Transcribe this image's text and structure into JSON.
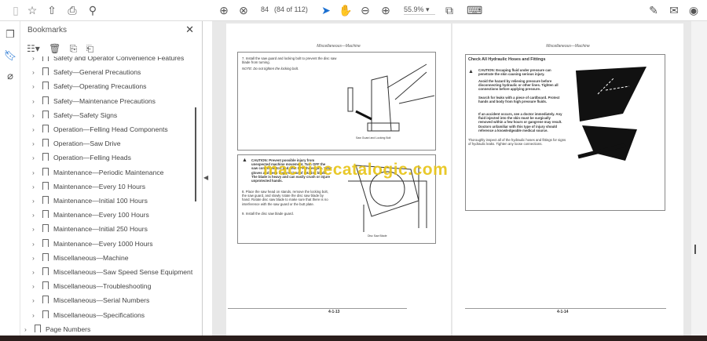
{
  "toolbar": {
    "page_input": "84",
    "page_count": "(84 of 112)",
    "zoom": "55.9%"
  },
  "bookmarks": {
    "title": "Bookmarks",
    "items": [
      "Safety and Operator Convenience Features",
      "Safety—General Precautions",
      "Safety—Operating Precautions",
      "Safety—Maintenance Precautions",
      "Safety—Safety Signs",
      "Operation—Felling Head Components",
      "Operation—Saw Drive",
      "Operation—Felling Heads",
      "Maintenance—Periodic Maintenance",
      "Maintenance—Every 10 Hours",
      "Maintenance—Initial 100 Hours",
      "Maintenance—Every 100 Hours",
      "Maintenance—Initial 250 Hours",
      "Maintenance—Every 1000 Hours",
      "Miscellaneous—Machine",
      "Miscellaneous—Saw Speed Sense Equipment",
      "Miscellaneous—Troubleshooting",
      "Miscellaneous—Serial Numbers",
      "Miscellaneous—Specifications"
    ],
    "root": "Page Numbers"
  },
  "left_page": {
    "header": "Miscellaneous—Machine",
    "step7": "7. Install the saw guard and locking bolt to prevent the disc saw blade from turning.",
    "note": "NOTE: Do not tighten the locking bolt.",
    "fig1": "Saw Guard and Locking Bolt",
    "caution": "CAUTION: Prevent possible injury from unexpected machine movement. Turn OFF the saw control switch and shut OFF the engine. Wear gloves and keep fingers clear of rotating blade. The blade is heavy and can easily crush or injure unprotected hands.",
    "step8": "8. Place the saw head on stands, remove the locking bolt, the saw guard, and slowly rotate the disc saw blade by hand. Rotate disc saw blade to make sure that there is no interference with the saw guard or the butt plate.",
    "step9": "9. Install the disc saw blade guard.",
    "fig2": "Disc Saw Blade",
    "page_no": "4-1-13"
  },
  "right_page": {
    "header": "Miscellaneous—Machine",
    "title": "Check All Hydraulic Hoses and Fittings",
    "caution": "CAUTION: Escaping fluid under pressure can penetrate the skin causing serious injury.",
    "p1": "Avoid the hazard by relieving pressure before disconnecting hydraulic or other lines. Tighten all connections before applying pressure.",
    "p2": "Search for leaks with a piece of cardboard. Protect hands and body from high pressure fluids.",
    "p3": "If an accident occurs, see a doctor immediately. Any fluid injected into the skin must be surgically removed within a few hours or gangrene may result. Doctors unfamiliar with this type of injury should reference a knowledgeable medical source.",
    "body": "Thoroughly inspect all of the hydraulic hoses and fittings for signs of hydraulic leaks. Tighten any loose connections.",
    "page_no": "4-1-14"
  },
  "watermark": "machinecatalogic.com"
}
